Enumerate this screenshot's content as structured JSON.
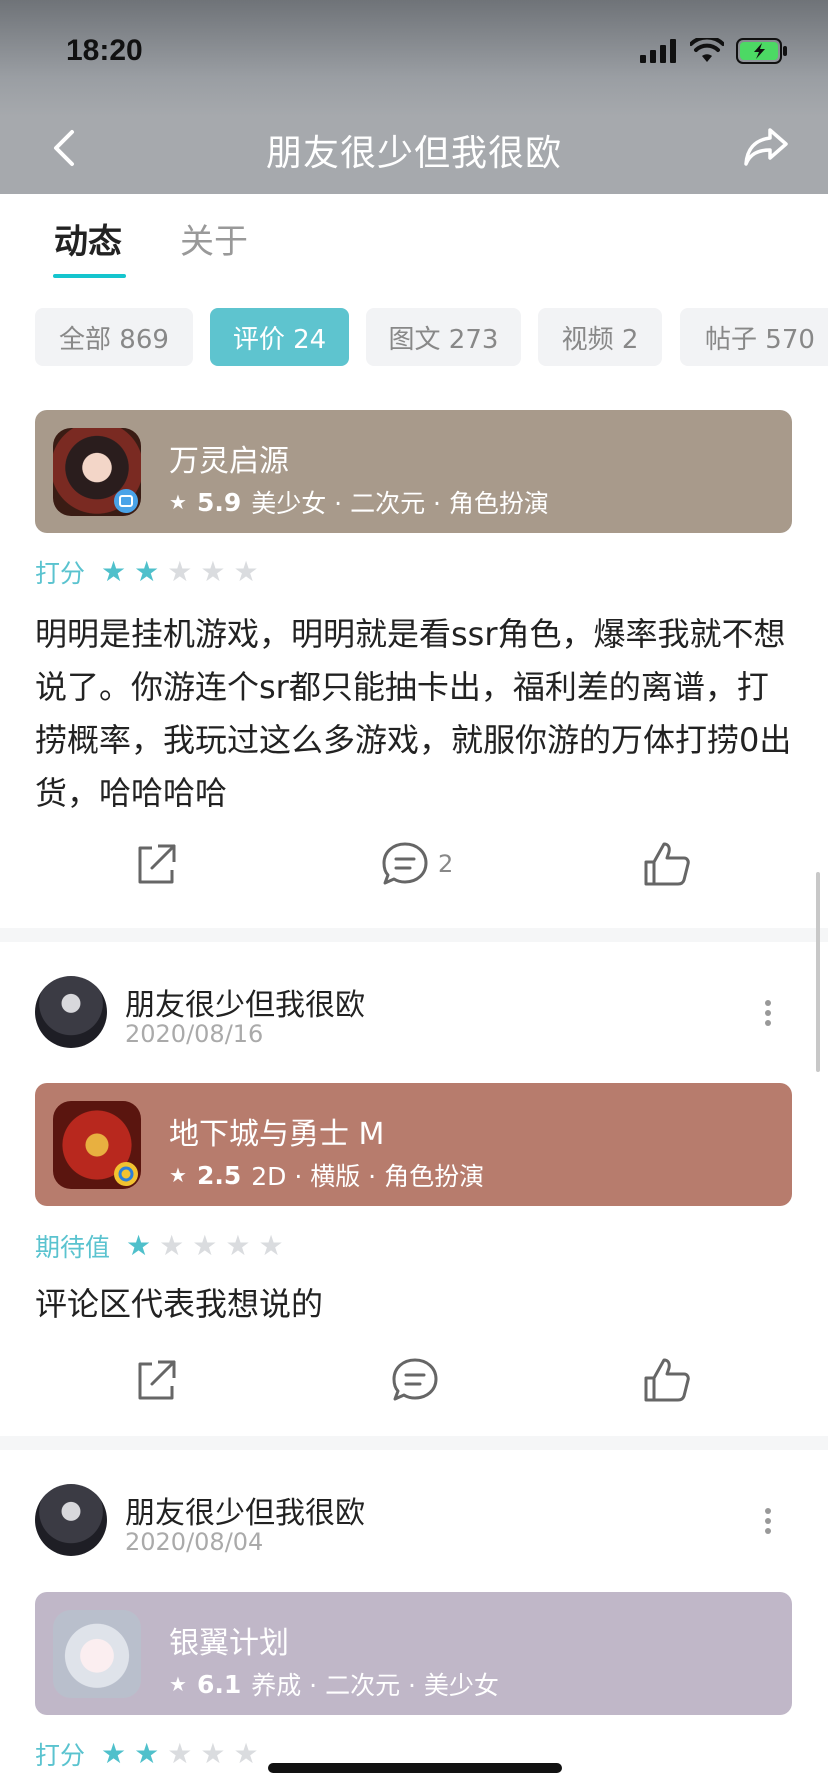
{
  "status_bar": {
    "time": "18:20"
  },
  "nav": {
    "title": "朋友很少但我很欧"
  },
  "tabs": [
    {
      "label": "动态"
    },
    {
      "label": "关于"
    }
  ],
  "chips": [
    {
      "label": "全部 869"
    },
    {
      "label": "评价 24"
    },
    {
      "label": "图文 273"
    },
    {
      "label": "视频 2"
    },
    {
      "label": "帖子 570"
    }
  ],
  "feed": [
    {
      "game": {
        "name": "万灵启源",
        "score": "5.9",
        "tags": "美少女 · 二次元 · 角色扮演",
        "bg_color": "#a89a8b"
      },
      "rating": {
        "label": "打分",
        "stars_on": 2,
        "stars_total": 5
      },
      "text": "明明是挂机游戏，明明就是看ssr角色，爆率我就不想说了。你游连个sr都只能抽卡出，福利差的离谱，打捞概率，我玩过这么多游戏，就服你游的万体打捞0出货，哈哈哈哈",
      "comment_count": "2"
    },
    {
      "author": {
        "name": "朋友很少但我很欧",
        "date": "2020/08/16"
      },
      "game": {
        "name": "地下城与勇士 M",
        "score": "2.5",
        "tags": "2D · 横版 · 角色扮演",
        "bg_color": "#b77c6d"
      },
      "rating": {
        "label": "期待值",
        "stars_on": 1,
        "stars_total": 5
      },
      "text": "评论区代表我想说的",
      "comment_count": ""
    },
    {
      "author": {
        "name": "朋友很少但我很欧",
        "date": "2020/08/04"
      },
      "game": {
        "name": "银翼计划",
        "score": "6.1",
        "tags": "养成 · 二次元 · 美少女",
        "bg_color": "#c0b7c8"
      },
      "rating": {
        "label": "打分",
        "stars_on": 2,
        "stars_total": 5
      }
    }
  ],
  "colors": {
    "accent": "#5ec4cf",
    "star_on": "#4fc0cb",
    "star_off": "#dadcdf"
  }
}
